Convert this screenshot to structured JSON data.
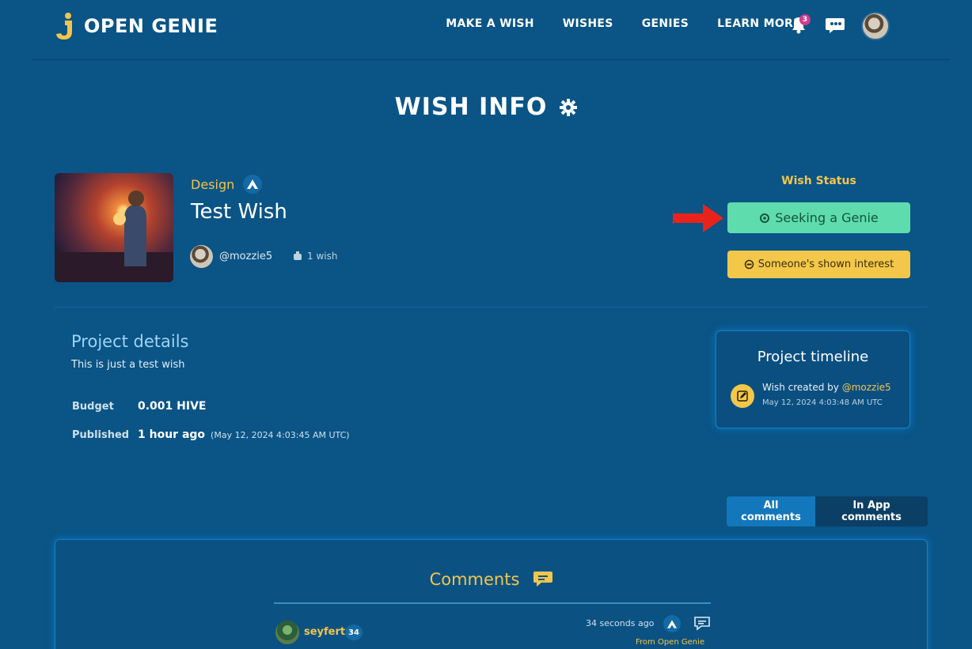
{
  "header": {
    "brand": "OPEN GENIE",
    "nav": [
      "MAKE A WISH",
      "WISHES",
      "GENIES",
      "LEARN MORE"
    ],
    "notification_count": "3"
  },
  "page": {
    "title": "WISH INFO"
  },
  "wish": {
    "category": "Design",
    "title": "Test Wish",
    "author": "@mozzie5",
    "wish_count": "1 wish",
    "status_label": "Wish Status",
    "status": "Seeking a Genie",
    "interest": "Someone's shown interest"
  },
  "project": {
    "heading": "Project details",
    "description": "This is just a test wish",
    "budget_label": "Budget",
    "budget_value": "0.001 HIVE",
    "published_label": "Published",
    "published_value": "1 hour ago",
    "published_exact": "(May 12, 2024 4:03:45 AM UTC)"
  },
  "timeline": {
    "heading": "Project timeline",
    "event_text": "Wish created by",
    "event_user": "@mozzie5",
    "event_date": "May 12, 2024 4:03:48 AM UTC"
  },
  "comments_tabs": [
    "All comments",
    "In App comments"
  ],
  "comments": {
    "heading": "Comments",
    "items": [
      {
        "user": "seyfert",
        "reputation": "34",
        "time": "34 seconds ago",
        "source": "From Open Genie"
      }
    ]
  },
  "colors": {
    "accent_yellow": "#f3c54c",
    "status_green": "#5edcae",
    "background": "#0a5486"
  }
}
